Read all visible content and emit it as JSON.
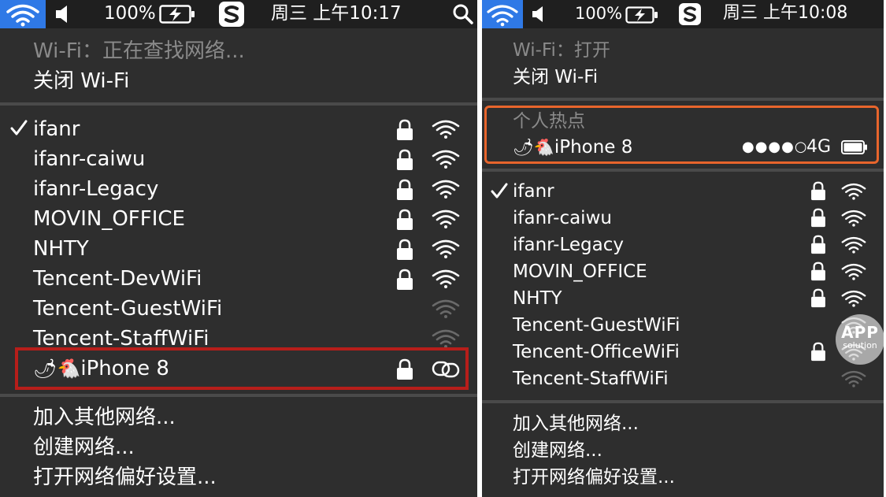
{
  "left": {
    "menubar": {
      "battery_percent": "100%",
      "clock": "周三 上午10:17"
    },
    "wifi_status": "Wi-Fi：正在查找网络...",
    "wifi_toggle": "关闭 Wi-Fi",
    "networks": [
      {
        "name": "ifanr",
        "connected": true,
        "locked": true,
        "signal": "strong"
      },
      {
        "name": "ifanr-caiwu",
        "connected": false,
        "locked": true,
        "signal": "strong"
      },
      {
        "name": "ifanr-Legacy",
        "connected": false,
        "locked": true,
        "signal": "strong"
      },
      {
        "name": "MOVIN_OFFICE",
        "connected": false,
        "locked": true,
        "signal": "strong"
      },
      {
        "name": "NHTY",
        "connected": false,
        "locked": true,
        "signal": "strong"
      },
      {
        "name": "Tencent-DevWiFi",
        "connected": false,
        "locked": true,
        "signal": "strong"
      },
      {
        "name": "Tencent-GuestWiFi",
        "connected": false,
        "locked": false,
        "signal": "weak"
      },
      {
        "name": "Tencent-StaffWiFi",
        "connected": false,
        "locked": false,
        "signal": "weak"
      }
    ],
    "hotspot": {
      "emoji": "🌶🐔",
      "name": "iPhone 8",
      "locked": true,
      "icon": "personal-hotspot-link-icon"
    },
    "actions": [
      "加入其他网络...",
      "创建网络...",
      "打开网络偏好设置..."
    ]
  },
  "right": {
    "menubar": {
      "battery_percent": "100%",
      "clock": "周三 上午10:08"
    },
    "wifi_status": "Wi-Fi：打开",
    "wifi_toggle": "关闭 Wi-Fi",
    "hotspot_section_label": "个人热点",
    "hotspot": {
      "emoji": "🌶🐔",
      "name": "iPhone 8",
      "signal_dots": "●●●●○",
      "network_type": "4G",
      "battery_level": 1.0
    },
    "networks": [
      {
        "name": "ifanr",
        "connected": true,
        "locked": true,
        "signal": "strong"
      },
      {
        "name": "ifanr-caiwu",
        "connected": false,
        "locked": true,
        "signal": "strong"
      },
      {
        "name": "ifanr-Legacy",
        "connected": false,
        "locked": true,
        "signal": "strong"
      },
      {
        "name": "MOVIN_OFFICE",
        "connected": false,
        "locked": true,
        "signal": "strong"
      },
      {
        "name": "NHTY",
        "connected": false,
        "locked": true,
        "signal": "strong"
      },
      {
        "name": "Tencent-GuestWiFi",
        "connected": false,
        "locked": false,
        "signal": "strong"
      },
      {
        "name": "Tencent-OfficeWiFi",
        "connected": false,
        "locked": true,
        "signal": "strong"
      },
      {
        "name": "Tencent-StaffWiFi",
        "connected": false,
        "locked": false,
        "signal": "weak"
      }
    ],
    "actions": [
      "加入其他网络...",
      "创建网络...",
      "打开网络偏好设置..."
    ],
    "watermark": {
      "line1": "APP",
      "line2": "solution"
    }
  },
  "colors": {
    "menu_bg": "#2e2e2e",
    "menubar_bg": "#1f1f1f",
    "accent_blue": "#2f79e6",
    "highlight_red": "#b71e1a",
    "highlight_orange": "#e8652c",
    "muted_text": "#8a8a8a"
  }
}
